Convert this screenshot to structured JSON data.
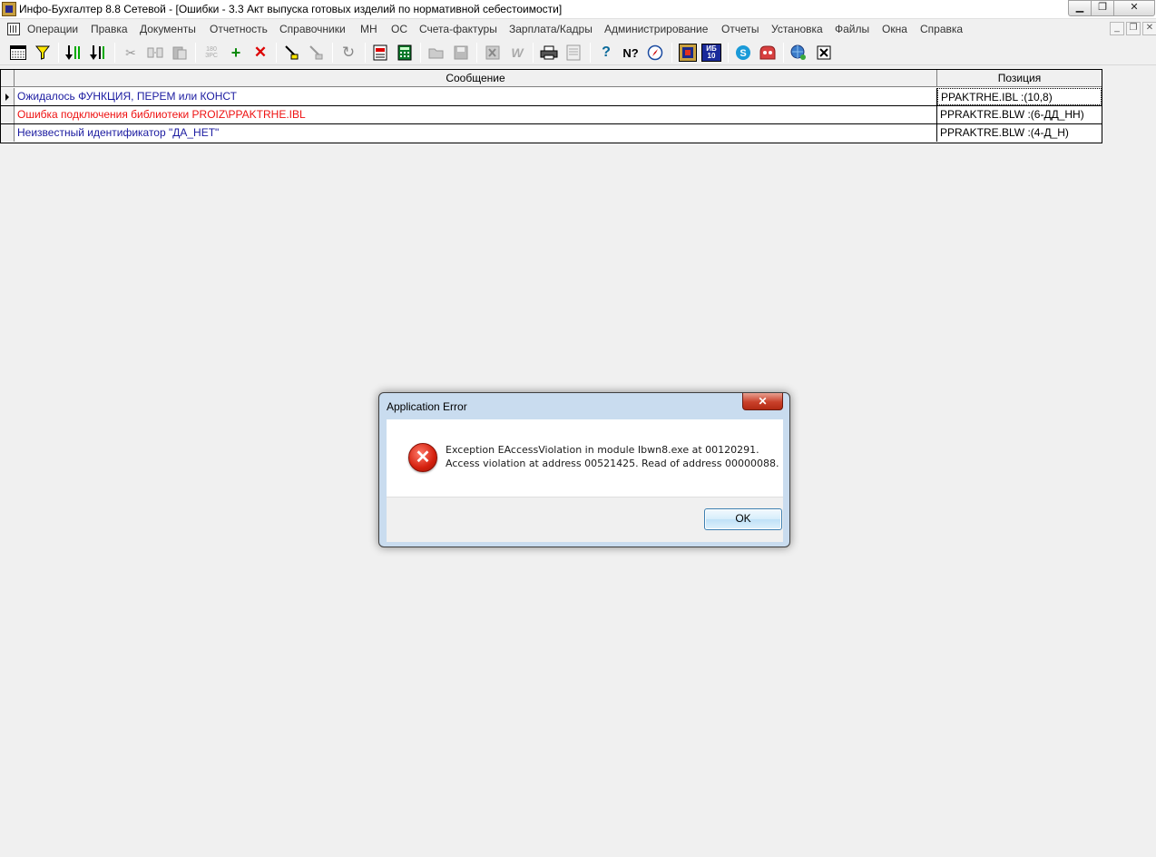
{
  "window": {
    "title": "Инфо-Бухгалтер 8.8 Сетевой - [Ошибки - 3.3 Акт выпуска готовых изделий по нормативной себестоимости]",
    "min_glyph": "▁",
    "max_glyph": "❐",
    "close_glyph": "✕"
  },
  "menu": {
    "items": [
      "Операции",
      "Правка",
      "Документы",
      "Отчетность",
      "Справочники",
      "МН",
      "ОС",
      "Счета-фактуры",
      "Зарплата/Кадры",
      "Администрирование",
      "Отчеты",
      "Установка",
      "Файлы",
      "Окна",
      "Справка"
    ],
    "mdi_min": "_",
    "mdi_restore": "❐",
    "mdi_close": "✕"
  },
  "toolbar": {
    "calc_glyph": "180",
    "calc_glyph_sub": "ЗРС",
    "book_label": "ИБ",
    "book_sub": "10"
  },
  "grid": {
    "columns": [
      "Сообщение",
      "Позиция"
    ],
    "rows": [
      {
        "message": "Ожидалось ФУНКЦИЯ, ПЕРЕМ или КОНСТ",
        "position": "PPAKTRHE.IBL :(10,8)",
        "color": "#1a1aa0",
        "current": true
      },
      {
        "message": "Ошибка подключения библиотеки PROIZ\\PPAKTRHE.IBL",
        "position": "PPRAKTRE.BLW :(6-ДД_НН)",
        "color": "#ee1111",
        "current": false
      },
      {
        "message": "Неизвестный идентификатор \"ДА_НЕТ\"",
        "position": "PPRAKTRE.BLW :(4-Д_Н)",
        "color": "#1a1aa0",
        "current": false
      }
    ]
  },
  "dialog": {
    "title": "Application Error",
    "close_glyph": "✕",
    "icon_glyph": "✕",
    "message_line1": "Exception EAccessViolation in module Ibwn8.exe at 00120291.",
    "message_line2": "Access violation at address 00521425. Read of address 00000088.",
    "ok_label": "OK"
  }
}
